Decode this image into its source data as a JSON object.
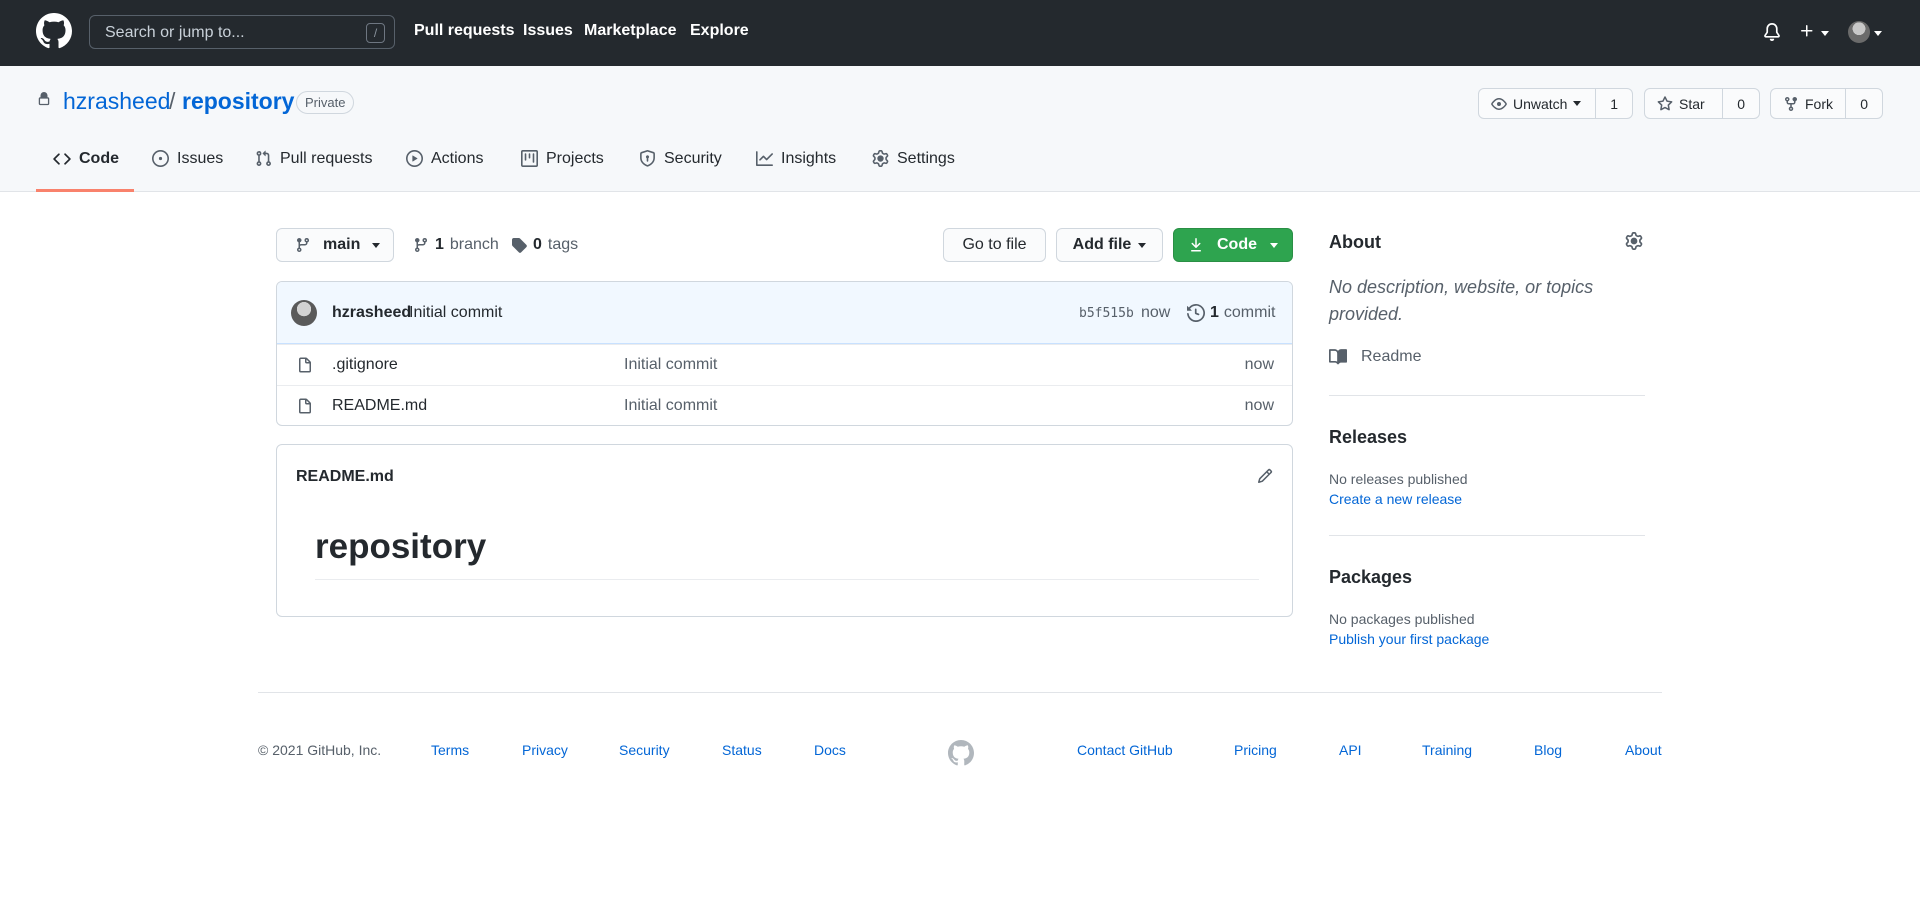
{
  "header": {
    "search_placeholder": "Search or jump to...",
    "slash_hint": "/",
    "nav": [
      "Pull requests",
      "Issues",
      "Marketplace",
      "Explore"
    ]
  },
  "repo": {
    "owner": "hzrasheed",
    "separator": "/",
    "name": "repository",
    "visibility": "Private",
    "watch_label": "Unwatch",
    "watch_count": "1",
    "star_label": "Star",
    "star_count": "0",
    "fork_label": "Fork",
    "fork_count": "0"
  },
  "tabs": [
    {
      "label": "Code",
      "icon": "code-icon",
      "active": true
    },
    {
      "label": "Issues",
      "icon": "issue-icon"
    },
    {
      "label": "Pull requests",
      "icon": "pull-request-icon"
    },
    {
      "label": "Actions",
      "icon": "play-icon"
    },
    {
      "label": "Projects",
      "icon": "project-icon"
    },
    {
      "label": "Security",
      "icon": "shield-icon"
    },
    {
      "label": "Insights",
      "icon": "graph-icon"
    },
    {
      "label": "Settings",
      "icon": "gear-icon"
    }
  ],
  "toolbar": {
    "branch": "main",
    "branch_count": "1",
    "branch_label": "branch",
    "tag_count": "0",
    "tag_label": "tags",
    "go_to_file": "Go to file",
    "add_file": "Add file",
    "code": "Code"
  },
  "commit": {
    "author": "hzrasheed",
    "message": "Initial commit",
    "sha": "b5f515b",
    "time": "now",
    "count": "1",
    "count_label": "commit"
  },
  "files": [
    {
      "name": ".gitignore",
      "message": "Initial commit",
      "time": "now"
    },
    {
      "name": "README.md",
      "message": "Initial commit",
      "time": "now"
    }
  ],
  "readme": {
    "title": "README.md",
    "heading": "repository"
  },
  "sidebar": {
    "about_title": "About",
    "about_desc": "No description, website, or topics provided.",
    "readme_label": "Readme",
    "releases_title": "Releases",
    "releases_empty": "No releases published",
    "releases_link": "Create a new release",
    "packages_title": "Packages",
    "packages_empty": "No packages published",
    "packages_link": "Publish your first package"
  },
  "footer": {
    "copyright": "© 2021 GitHub, Inc.",
    "links_left": [
      "Terms",
      "Privacy",
      "Security",
      "Status",
      "Docs"
    ],
    "links_right": [
      "Contact GitHub",
      "Pricing",
      "API",
      "Training",
      "Blog",
      "About"
    ]
  },
  "colors": {
    "header_bg": "#24292e",
    "link": "#0366d6",
    "green": "#2ea44f",
    "tab_underline": "#f9826c"
  }
}
